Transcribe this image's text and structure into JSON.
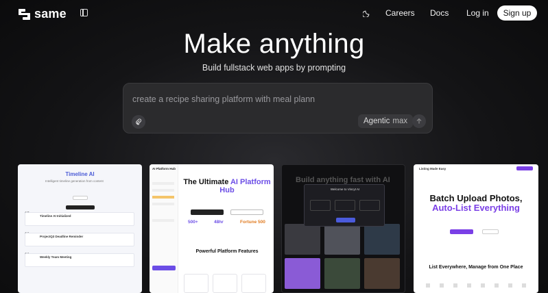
{
  "brand": {
    "name": "same"
  },
  "nav": {
    "careers": "Careers",
    "docs": "Docs",
    "login": "Log in",
    "signup": "Sign up"
  },
  "hero": {
    "title": "Make anything",
    "subtitle": "Build fullstack web apps by prompting"
  },
  "prompt": {
    "text": "create a recipe sharing platform with meal plann",
    "mode": "Agentic",
    "tier": "max"
  },
  "cards": [
    {
      "brand": "Timeline AI",
      "items": [
        "Timeline AI Initialized",
        "ProjectQ3 Deadline Reminder",
        "Weekly Team Meeting"
      ],
      "dates": [
        "25",
        "23",
        "20"
      ]
    },
    {
      "sidebar_title": "AI Platform Hub",
      "headline_a": "The Ultimate ",
      "headline_b": "AI Platform Hub",
      "stats": [
        "500+",
        "48hr",
        "Fortune 500"
      ],
      "section": "Powerful Platform Features"
    },
    {
      "headline": "Build anything fast with AI",
      "modal": "Welcome to Vincyt AI"
    },
    {
      "logo": "Listing Made Easy",
      "headline_a": "Batch Upload Photos,",
      "headline_b": "Auto-List Everything",
      "section": "List Everywhere, Manage from One Place"
    }
  ],
  "colors": {
    "accent_purple": "#6b4de6",
    "accent_blue": "#4a5bd6"
  },
  "icons": {
    "logo": "same-logo-icon",
    "sidebar": "sidebar-toggle-icon",
    "theme": "moon-icon",
    "attach": "paperclip-icon",
    "send": "arrow-up-icon"
  }
}
